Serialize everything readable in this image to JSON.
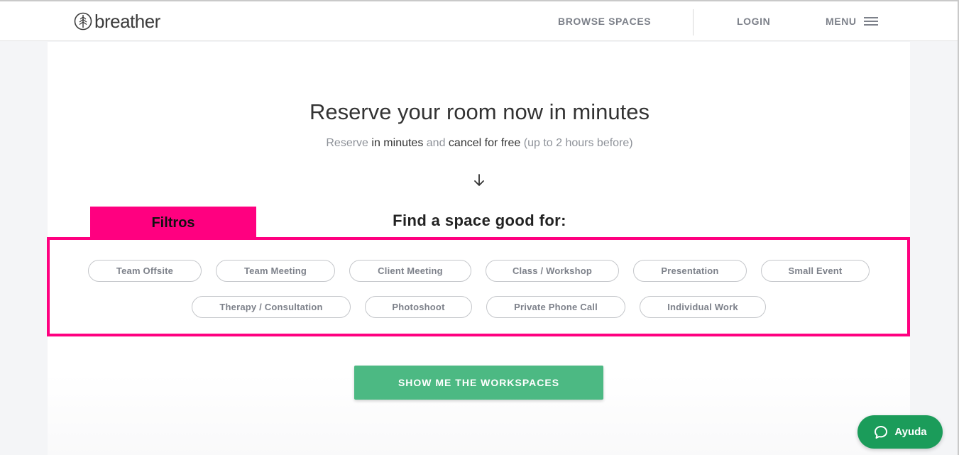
{
  "header": {
    "logo_text": "breather",
    "nav": {
      "browse": "BROWSE SPACES",
      "login": "LOGIN",
      "menu": "MENU"
    }
  },
  "hero": {
    "title": "Reserve your room now in minutes",
    "subtitle": {
      "part1": "Reserve ",
      "part2": "in minutes",
      "part3": " and ",
      "part4": "cancel for free",
      "part5": " (up to 2 hours before)"
    }
  },
  "filters": {
    "tab_label": "Filtros",
    "title": "Find a space good for:",
    "row1": [
      "Team Offsite",
      "Team Meeting",
      "Client Meeting",
      "Class / Workshop",
      "Presentation",
      "Small Event"
    ],
    "row2": [
      "Therapy / Consultation",
      "Photoshoot",
      "Private Phone Call",
      "Individual Work"
    ]
  },
  "cta": {
    "label": "SHOW ME THE WORKSPACES"
  },
  "help": {
    "label": "Ayuda"
  },
  "colors": {
    "accent_pink": "#ff0080",
    "cta_green": "#4cb983",
    "help_green": "#1b9c5a"
  }
}
